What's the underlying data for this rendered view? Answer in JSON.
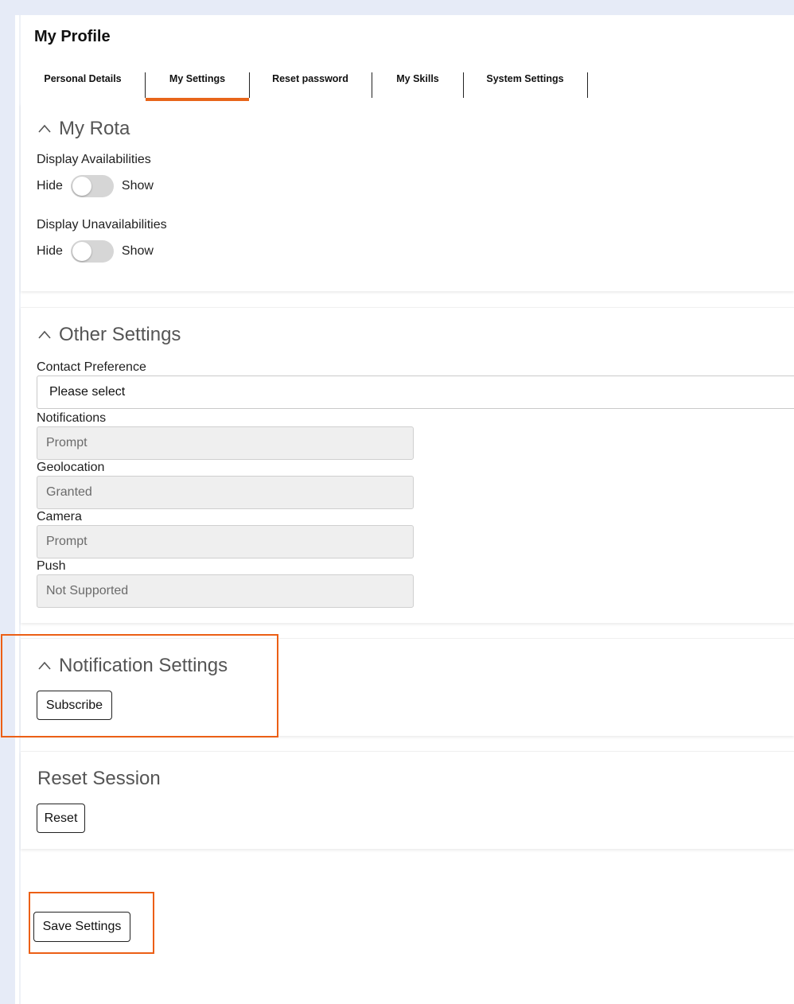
{
  "page": {
    "title": "My Profile"
  },
  "tabs": [
    {
      "label": "Personal Details",
      "active": false
    },
    {
      "label": "My Settings",
      "active": true
    },
    {
      "label": "Reset password",
      "active": false
    },
    {
      "label": "My Skills",
      "active": false
    },
    {
      "label": "System Settings",
      "active": false
    }
  ],
  "rota": {
    "title": "My Rota",
    "availabilities": {
      "label": "Display Availabilities",
      "off_label": "Hide",
      "on_label": "Show",
      "value": "Hide"
    },
    "unavailabilities": {
      "label": "Display Unavailabilities",
      "off_label": "Hide",
      "on_label": "Show",
      "value": "Hide"
    }
  },
  "other": {
    "title": "Other Settings",
    "contact_label": "Contact Preference",
    "contact_value": "Please select",
    "notifications_label": "Notifications",
    "notifications_value": "Prompt",
    "geolocation_label": "Geolocation",
    "geolocation_value": "Granted",
    "camera_label": "Camera",
    "camera_value": "Prompt",
    "push_label": "Push",
    "push_value": "Not Supported"
  },
  "notification_settings": {
    "title": "Notification Settings",
    "subscribe_label": "Subscribe"
  },
  "reset_session": {
    "title": "Reset Session",
    "reset_label": "Reset"
  },
  "save_label": "Save Settings",
  "colors": {
    "accent": "#e8651a",
    "highlight": "#ec5f15",
    "sidebar": "#e6ebf7"
  },
  "icons": {
    "section_toggle": "chevron-up-icon"
  }
}
